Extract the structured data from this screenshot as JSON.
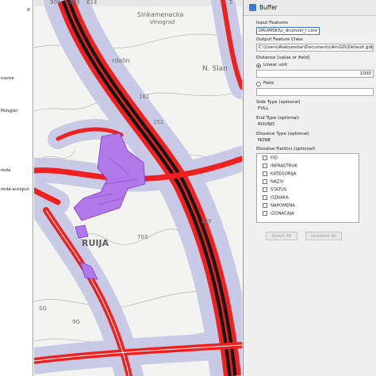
{
  "toc": {
    "close_glyph": "x",
    "lines": [
      "nacne",
      "Polygon",
      "reda",
      "reda-autoput"
    ]
  },
  "map": {
    "labels": {
      "top_a": "909",
      "top_b": "609",
      "top_c": "614",
      "top_d": "5",
      "town_top": "Sinkamenacka",
      "town_top2": "Vinograd",
      "ardelin": "rdelin",
      "sland": "N. Slan",
      "n161": "161",
      "n151": "151",
      "n139": "139",
      "ruija": "RUIJA",
      "n703": "703",
      "sg": "SG",
      "g9g": "9G"
    },
    "colors": {
      "road_red": "#ee2020",
      "road_black": "#141414",
      "buffer": "#c9cbe6",
      "purple": "#b277e8",
      "purple_edge": "#7a3fd0",
      "contour": "#9a9a9a",
      "map_bg": "#f3f3f1"
    }
  },
  "dialog": {
    "title": "Buffer",
    "input_label": "Input Features",
    "input_value": "DRUMSKI\\s_drumski_l Line",
    "output_label": "Output Feature Class",
    "output_value": "C:\\Users\\Aleksandar\\Documents\\ArcGIS\\Default.gdb\\p",
    "distance_label": "Distance [value or field]",
    "linear_unit_label": "Linear unit",
    "linear_value": "1000",
    "field_label": "Field",
    "side_type_label": "Side Type (optional)",
    "side_type_value": "FULL",
    "end_type_label": "End Type (optional)",
    "end_type_value": "ROUND",
    "dissolve_type_label": "Dissolve Type (optional)",
    "dissolve_type_value": "NONE",
    "dissolve_fields_label": "Dissolve Field(s) (optional)",
    "fields": [
      "FID",
      "INFRASTRUK",
      "KATEGORIJA",
      "NAZIV",
      "STATUS",
      "OZNAKA",
      "NAPOMENA",
      "IZGNACAJA"
    ],
    "select_all": "Select All",
    "unselect_all": "Unselect All"
  }
}
